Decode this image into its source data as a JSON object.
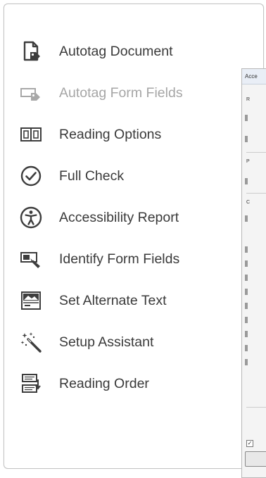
{
  "menu": {
    "items": [
      {
        "label": "Autotag Document",
        "icon": "autotag-document-icon",
        "enabled": true
      },
      {
        "label": "Autotag Form Fields",
        "icon": "autotag-form-fields-icon",
        "enabled": false
      },
      {
        "label": "Reading Options",
        "icon": "reading-options-icon",
        "enabled": true
      },
      {
        "label": "Full Check",
        "icon": "full-check-icon",
        "enabled": true
      },
      {
        "label": "Accessibility Report",
        "icon": "accessibility-report-icon",
        "enabled": true
      },
      {
        "label": "Identify Form Fields",
        "icon": "identify-form-fields-icon",
        "enabled": true
      },
      {
        "label": "Set Alternate Text",
        "icon": "set-alternate-text-icon",
        "enabled": true
      },
      {
        "label": "Setup Assistant",
        "icon": "setup-assistant-icon",
        "enabled": true
      },
      {
        "label": "Reading Order",
        "icon": "reading-order-icon",
        "enabled": true
      }
    ]
  },
  "dialog": {
    "title": "Acce",
    "glyph_1": "R",
    "glyph_2": "P",
    "glyph_3": "C",
    "checkbox_mark": "✓"
  },
  "colors": {
    "text": "#3a3a3a",
    "disabled_text": "#a6a6a6",
    "icon": "#3d3d3d",
    "panel_border": "#c4c4c4"
  }
}
